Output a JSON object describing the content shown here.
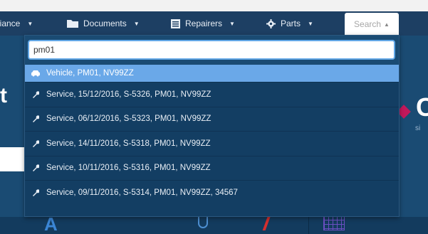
{
  "navbar": {
    "items": [
      {
        "label": "liance",
        "icon": "none"
      },
      {
        "label": "Documents",
        "icon": "folder-icon"
      },
      {
        "label": "Repairers",
        "icon": "list-icon"
      },
      {
        "label": "Parts",
        "icon": "gear-icon"
      }
    ],
    "search_tab": {
      "label": "Search"
    }
  },
  "search": {
    "value": "pm01"
  },
  "results": [
    {
      "label": "Vehicle, PM01, NV99ZZ",
      "icon": "car-icon",
      "active": true
    },
    {
      "label": "Service, 15/12/2016, S-5326, PM01, NV99ZZ",
      "icon": "wrench-icon",
      "active": false
    },
    {
      "label": "Service, 06/12/2016, S-5323, PM01, NV99ZZ",
      "icon": "wrench-icon",
      "active": false
    },
    {
      "label": "Service, 14/11/2016, S-5318, PM01, NV99ZZ",
      "icon": "wrench-icon",
      "active": false
    },
    {
      "label": "Service, 10/11/2016, S-5316, PM01, NV99ZZ",
      "icon": "wrench-icon",
      "active": false
    },
    {
      "label": "Service, 09/11/2016, S-5314, PM01, NV99ZZ, 34567",
      "icon": "wrench-icon",
      "active": false
    }
  ],
  "background": {
    "left_letter": "t",
    "right_letter": "C",
    "right_sub": "si",
    "bottom_letter": "A"
  },
  "colors": {
    "navbar": "#1d3f63",
    "dropdown": "#133e63",
    "active_row": "#6aa8e8",
    "input_border": "#62a7e6"
  }
}
